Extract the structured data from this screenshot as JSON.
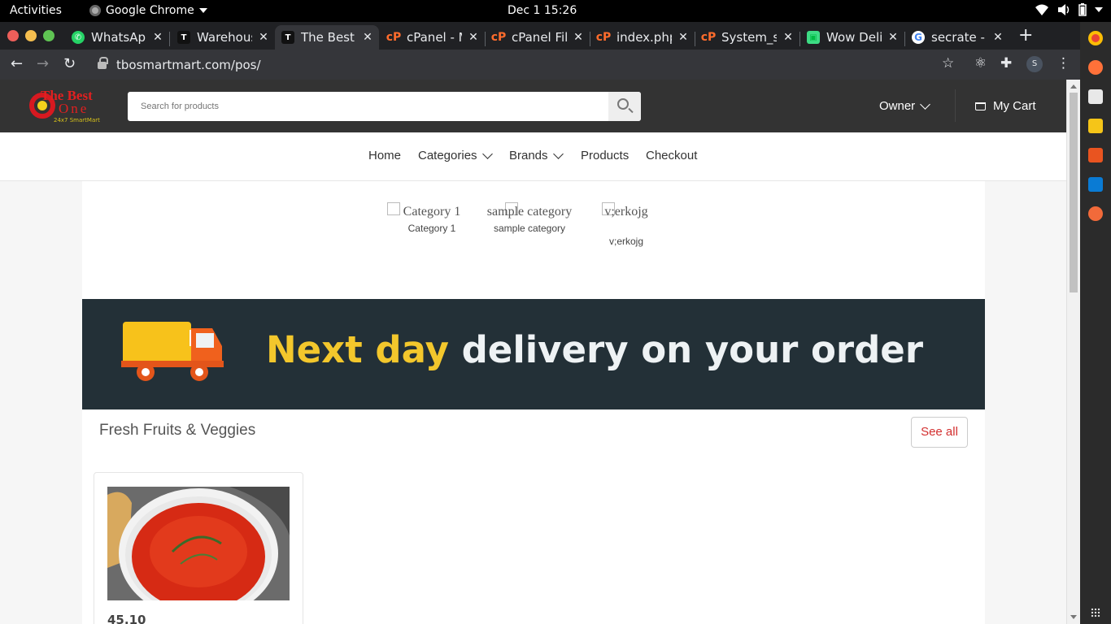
{
  "system_bar": {
    "activities": "Activities",
    "app_name": "Google Chrome",
    "clock": "Dec 1  15:26"
  },
  "tabs": [
    {
      "title": "WhatsApp",
      "icon": "whatsapp-icon",
      "color": "#25d366"
    },
    {
      "title": "Warehouse",
      "icon": "t-logo-icon",
      "color": "#111111"
    },
    {
      "title": "The Best",
      "icon": "t-logo-icon",
      "color": "#111111",
      "active": true
    },
    {
      "title": "cPanel - M",
      "icon": "cpanel-icon",
      "color": "#ff6c2c"
    },
    {
      "title": "cPanel Fil",
      "icon": "cpanel-icon",
      "color": "#ff6c2c"
    },
    {
      "title": "index.php",
      "icon": "cpanel-icon",
      "color": "#ff6c2c"
    },
    {
      "title": "System_s",
      "icon": "cpanel-icon",
      "color": "#ff6c2c"
    },
    {
      "title": "Wow Deli",
      "icon": "android-icon",
      "color": "#3ddc84"
    },
    {
      "title": "secrate - G",
      "icon": "google-icon",
      "color": "#4285f4"
    }
  ],
  "browser": {
    "url": "tbosmartmart.com/pos/",
    "profile_initial": "S"
  },
  "site": {
    "logo": {
      "line1": "The Best",
      "line2": "One",
      "tagline": "24x7 SmartMart"
    },
    "search_placeholder": "Search for products",
    "owner_label": "Owner",
    "cart_label": "My Cart"
  },
  "nav": {
    "home": "Home",
    "categories": "Categories",
    "brands": "Brands",
    "products": "Products",
    "checkout": "Checkout"
  },
  "categories": [
    {
      "alt": "Category 1",
      "label": "Category 1"
    },
    {
      "alt": "sample category",
      "label": "sample category"
    },
    {
      "alt": "v;erkojg",
      "label": "v;erkojg"
    }
  ],
  "banner": {
    "headline_accent": "Next day",
    "headline_rest": " delivery on your order",
    "accent_color": "#f3c72c"
  },
  "section": {
    "title": "Fresh Fruits & Veggies",
    "see_all": "See all"
  },
  "products": [
    {
      "price": "45.10",
      "image": "tomato-soup-bowl"
    }
  ]
}
